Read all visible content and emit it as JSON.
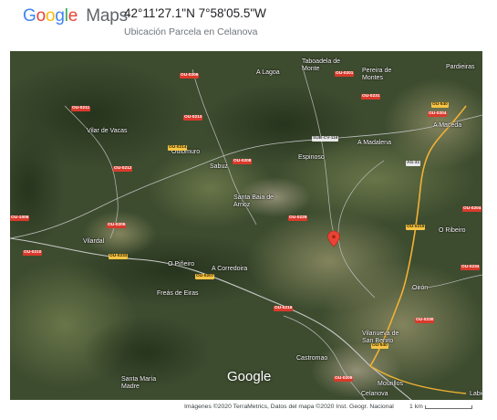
{
  "header": {
    "logo_letters": [
      {
        "char": "G",
        "color": "#4285F4"
      },
      {
        "char": "o",
        "color": "#EA4335"
      },
      {
        "char": "o",
        "color": "#FBBC05"
      },
      {
        "char": "g",
        "color": "#4285F4"
      },
      {
        "char": "l",
        "color": "#34A853"
      },
      {
        "char": "e",
        "color": "#EA4335"
      }
    ],
    "logo_maps": "Maps",
    "coordinates": "42°11'27.1\"N 7°58'05.5\"W",
    "subtitle": "Ubicación Parcela en Celanova"
  },
  "map": {
    "marker_color": "#EA4335",
    "watermark": "Google",
    "places": [
      {
        "name": "A Lagoa"
      },
      {
        "name": "Taboadela de Monte"
      },
      {
        "name": "Pereira de Montes"
      },
      {
        "name": "Pardieiras"
      },
      {
        "name": "Vilar de Vacas"
      },
      {
        "name": "Outomuro"
      },
      {
        "name": "Sabuz"
      },
      {
        "name": "Espinoso"
      },
      {
        "name": "A Madalena"
      },
      {
        "name": "A Maceda"
      },
      {
        "name": "Santa Baia de Arnoz"
      },
      {
        "name": "O Ribeiro"
      },
      {
        "name": "Vilardal"
      },
      {
        "name": "O Piñeiro"
      },
      {
        "name": "A Corredoira"
      },
      {
        "name": "Freás de Eiras"
      },
      {
        "name": "Oirón"
      },
      {
        "name": "Vilanueva de San Benito"
      },
      {
        "name": "Castromao"
      },
      {
        "name": "Santa María Madre"
      },
      {
        "name": "Mourillos"
      },
      {
        "name": "Celanova"
      },
      {
        "name": "Labio"
      }
    ],
    "roads": [
      "OU-0206",
      "OU-0201",
      "OU-0204",
      "OU-0214",
      "OU-0212",
      "OU-1006",
      "OU-0211",
      "SUB-CV-116",
      "OU-0208",
      "OU-0231",
      "OU-0215",
      "OU-0213",
      "OU-0229",
      "OU-0233",
      "OU-0204",
      "OU-540",
      "AG-31",
      "OU-0209",
      "OU-0205",
      "OU-0230",
      "OU-0207",
      "OU-0234",
      "OU-540",
      "OU-0216",
      "OU-0210"
    ]
  },
  "footer": {
    "attribution": "Imágenes ©2020 TerraMetrics, Datos del mapa ©2020 Inst. Geogr. Nacional",
    "scale_label": "1 km"
  }
}
